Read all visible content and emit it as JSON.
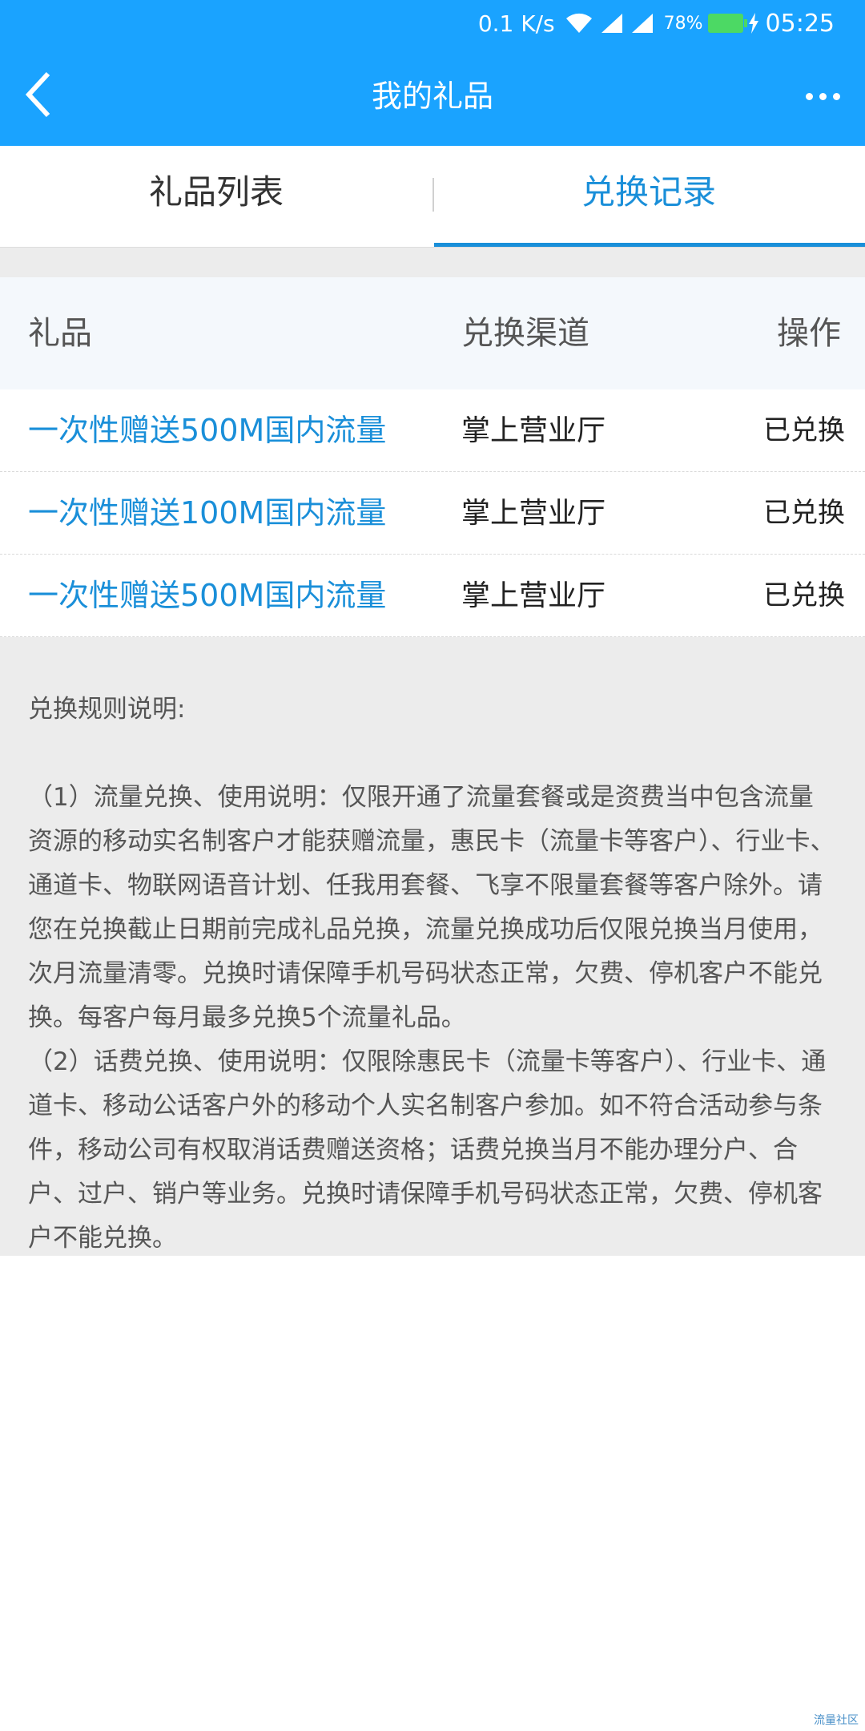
{
  "status_bar": {
    "net_speed": "0.1 K/s",
    "battery_pct": "78%",
    "time": "05:25",
    "icons": [
      "wifi-icon",
      "signal-icon",
      "signal-icon",
      "battery-icon",
      "charging-icon"
    ],
    "battery_color": "#4cd964"
  },
  "nav": {
    "title": "我的礼品",
    "back_icon": "chevron-left-icon",
    "more_icon": "more-dots-icon",
    "color": "#1aa3ff"
  },
  "tabs": [
    {
      "label": "礼品列表",
      "active": false
    },
    {
      "label": "兑换记录",
      "active": true
    }
  ],
  "accent_color": "#1a8fd9",
  "table": {
    "headers": [
      "礼品",
      "兑换渠道",
      "操作"
    ],
    "rows": [
      {
        "gift": "一次性赠送500M国内流量",
        "channel": "掌上营业厅",
        "action": "已兑换"
      },
      {
        "gift": "一次性赠送100M国内流量",
        "channel": "掌上营业厅",
        "action": "已兑换"
      },
      {
        "gift": "一次性赠送500M国内流量",
        "channel": "掌上营业厅",
        "action": "已兑换"
      }
    ]
  },
  "rules": {
    "title": "兑换规则说明:",
    "items": [
      "（1）流量兑换、使用说明：仅限开通了流量套餐或是资费当中包含流量资源的移动实名制客户才能获赠流量，惠民卡（流量卡等客户）、行业卡、通道卡、物联网语音计划、任我用套餐、飞享不限量套餐等客户除外。请您在兑换截止日期前完成礼品兑换，流量兑换成功后仅限兑换当月使用，次月流量清零。兑换时请保障手机号码状态正常，欠费、停机客户不能兑换。每客户每月最多兑换5个流量礼品。",
      "（2）话费兑换、使用说明：仅限除惠民卡（流量卡等客户）、行业卡、通道卡、移动公话客户外的移动个人实名制客户参加。如不符合活动参与条件，移动公司有权取消话费赠送资格；话费兑换当月不能办理分户、合户、过户、销户等业务。兑换时请保障手机号码状态正常，欠费、停机客户不能兑换。"
    ]
  },
  "watermark": "流量社区"
}
